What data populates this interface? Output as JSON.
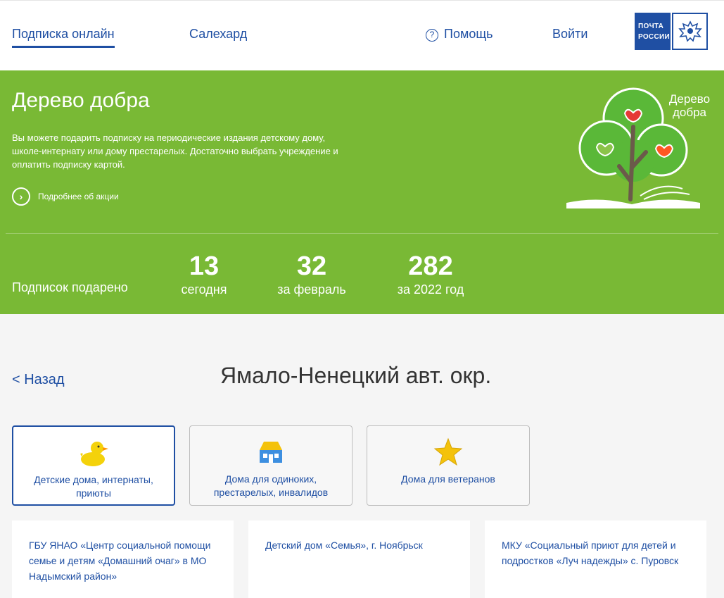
{
  "header": {
    "subscribe_online": "Подписка онлайн",
    "city": "Салехард",
    "help": "Помощь",
    "help_icon": "?",
    "login": "Войти",
    "logo_line1": "ПОЧТА",
    "logo_line2": "РОССИИ"
  },
  "banner": {
    "title": "Дерево добра",
    "description": "Вы можете подарить подписку на периодические издания детскому дому, школе-интернату или дому престарелых. Достаточно выбрать учреждение и оплатить подписку картой.",
    "more_link": "Подробнее об акции",
    "tree_label": "Дерево добра",
    "stats_label": "Подписок подарено",
    "stats": [
      {
        "value": "13",
        "caption": "сегодня"
      },
      {
        "value": "32",
        "caption": "за февраль"
      },
      {
        "value": "282",
        "caption": "за 2022 год"
      }
    ]
  },
  "region": {
    "back": "<  Назад",
    "title": "Ямало-Ненецкий авт. окр."
  },
  "categories": [
    {
      "label": "Детские дома, интернаты, приюты",
      "icon": "duck-icon",
      "active": true
    },
    {
      "label": "Дома для одиноких, престарелых, инвалидов",
      "icon": "house-icon",
      "active": false
    },
    {
      "label": "Дома для ветеранов",
      "icon": "star-icon",
      "active": false
    }
  ],
  "organizations": [
    {
      "name": "ГБУ ЯНАО «Центр социальной помощи семье и детям «Домашний очаг» в МО Надымский район»"
    },
    {
      "name": "Детский дом «Семья», г. Ноябрьск"
    },
    {
      "name": "МКУ «Социальный приют для детей и подростков «Луч надежды» с. Пуровск"
    }
  ],
  "colors": {
    "brand_blue": "#1f4fa3",
    "banner_green": "#79b935",
    "page_bg": "#f5f5f5"
  }
}
